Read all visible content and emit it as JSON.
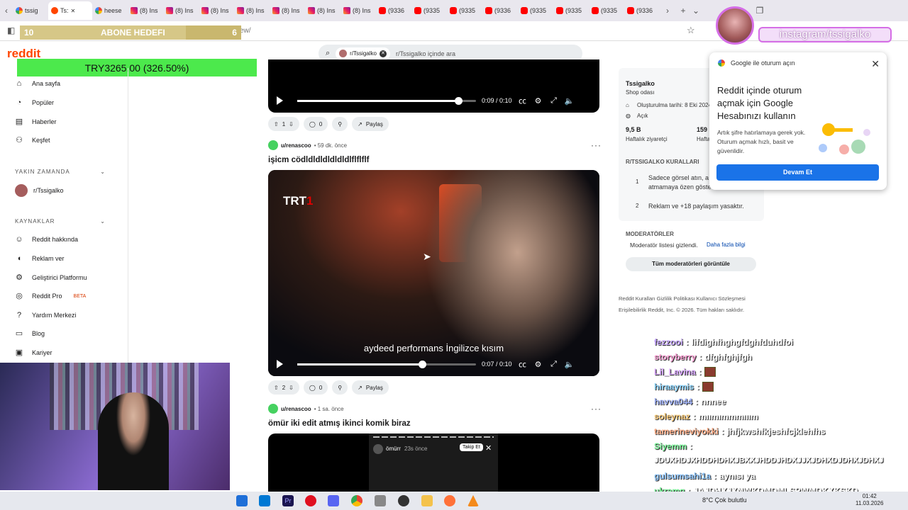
{
  "browser": {
    "tabs": [
      {
        "icon": "google-icon",
        "label": "tssig"
      },
      {
        "icon": "reddit-icon",
        "label": "Ts:",
        "active": true
      },
      {
        "icon": "google-icon",
        "label": "heese"
      },
      {
        "icon": "instagram-icon",
        "label": "(8) Ins"
      },
      {
        "icon": "instagram-icon",
        "label": "(8) Ins"
      },
      {
        "icon": "instagram-icon",
        "label": "(8) Ins"
      },
      {
        "icon": "instagram-icon",
        "label": "(8) Ins"
      },
      {
        "icon": "instagram-icon",
        "label": "(8) Ins"
      },
      {
        "icon": "instagram-icon",
        "label": "(8) Ins"
      },
      {
        "icon": "instagram-icon",
        "label": "(8) Ins"
      },
      {
        "icon": "youtube-icon",
        "label": "(9336"
      },
      {
        "icon": "youtube-icon",
        "label": "(9335"
      },
      {
        "icon": "youtube-icon",
        "label": "(9335"
      },
      {
        "icon": "youtube-icon",
        "label": "(9336"
      },
      {
        "icon": "youtube-icon",
        "label": "(9335"
      },
      {
        "icon": "youtube-icon",
        "label": "(9335"
      },
      {
        "icon": "youtube-icon",
        "label": "(9335"
      },
      {
        "icon": "youtube-icon",
        "label": "(9336"
      }
    ],
    "url_fragment": "ew/"
  },
  "overlay": {
    "goal_left": "10",
    "goal_label": "ABONE HEDEFI",
    "goal_right": "6",
    "goal_progress": 0.75,
    "donation": "TRY3265.00 (326.50%)",
    "instagram": "instagram/tssigalko"
  },
  "reddit": {
    "logo": "reddit",
    "search_chip": "r/Tssigalko",
    "search_placeholder": "r/Tssigalko içinde ara",
    "nav": {
      "home": "Ana sayfa",
      "popular": "Popüler",
      "news": "Haberler",
      "explore": "Keşfet",
      "recent_header": "YAKIN ZAMANDA",
      "recent_item": "r/Tssigalko",
      "resources_header": "KAYNAKLAR",
      "resources": [
        "Reddit hakkında",
        "Reklam ver",
        "Geliştirici Platformu",
        "Reddit Pro",
        "Yardım Merkezi",
        "Blog",
        "Kariyer"
      ],
      "beta": "BETA"
    },
    "posts": [
      {
        "time": "0:09 / 0:10",
        "progress": 0.9,
        "upvotes": "1",
        "comments": "0",
        "share": "Paylaş"
      },
      {
        "author": "u/renascoo",
        "age": "• 59 dk. önce",
        "title": "işicm cödldldldldldldlflflflf",
        "overlay_logo": "TRT",
        "overlay_logo_num": "1",
        "caption": "aydeed performans İngilizce kısım",
        "time": "0:07 / 0:10",
        "progress": 0.7,
        "upvotes": "2",
        "comments": "0",
        "share": "Paylaş"
      },
      {
        "author": "u/renascoo",
        "age": "• 1 sa. önce",
        "title": "ömür iki edit atmış ikinci komik biraz",
        "story_user": "ömürr",
        "story_age": "23s önce",
        "story_follow": "Takip Et"
      }
    ],
    "sidebar": {
      "name": "Tssigalko",
      "subtitle": "Shop odası",
      "created": "Oluşturulma tarihi: 8 Eki 2024",
      "status": "Açık",
      "visitors": "9,5 B",
      "visitors_label": "Haftalık ziyaretçi",
      "contrib": "159",
      "contrib_label": "Haftal",
      "rules_header": "R/TSSIGALKO KURALLARI",
      "rule1_num": "1",
      "rule1": "Sadece görsel atın, a",
      "rule1b": "atmamaya özen göste",
      "rule2_num": "2",
      "rule2": "Reklam ve +18 paylaşım yasaktır.",
      "mods_header": "MODERATÖRLER",
      "mods_text": "Moderatör listesi gizlendi.",
      "mods_more": "Daha fazla bilgi",
      "mods_button": "Tüm moderatörleri görüntüle",
      "footer1": "Reddit Kuralları   Gizlilik Politikası   Kullanıcı Sözleşmesi",
      "footer2": "Erişilebilirlik   Reddit, Inc. © 2026. Tüm hakları saklıdır."
    },
    "google_popup": {
      "header": "Google ile oturum açın",
      "title": "Reddit içinde oturum açmak için Google Hesabınızı kullanın",
      "text": "Artık şifre hatırlamaya gerek yok. Oturum açmak hızlı, basit ve güvenlidir.",
      "button": "Devam Et"
    }
  },
  "chat": [
    {
      "name": "fezzooi",
      "msg": "lifdighfhghgfdghfduhdfoi",
      "color": "#c7a7ff"
    },
    {
      "name": "storyberry",
      "msg": "dfghfghjfgh",
      "color": "#ff9fd6"
    },
    {
      "name": "Lil_Lavina",
      "msg": "",
      "color": "#d8a6ff",
      "emote": true
    },
    {
      "name": "hiraaymis",
      "msg": "",
      "color": "#8fd7ff",
      "emote": true
    },
    {
      "name": "havva044",
      "msg": "nnnee",
      "color": "#a6b8ff"
    },
    {
      "name": "soleynaz",
      "msg": "mıımımmmııım",
      "color": "#ffce7a"
    },
    {
      "name": "tamerineviyokki",
      "msg": "jhfjkwshfkjeshfcjklehfhs",
      "color": "#ffb08a"
    },
    {
      "name": "Siyemm",
      "msg": "",
      "color": "#7cf59a"
    },
    {
      "name": "",
      "msg": "JDUXHDJXHDDHDHXJBXXJHDDJHDXJJXJDHXDJDHXJDHXJ",
      "color": "#fff"
    },
    {
      "name": "gulsumsahi1a",
      "msg": "aynısı ya",
      "color": "#8fc7ff"
    },
    {
      "name": "ukramg",
      "msg": "JAJDHXJXNWKDMDMLSPWMDKXKSKD",
      "color": "#7cf59a"
    }
  ],
  "taskbar": {
    "weather": "8°C  Çok bulutlu",
    "time": "01:42",
    "date": "11.03.2026"
  }
}
